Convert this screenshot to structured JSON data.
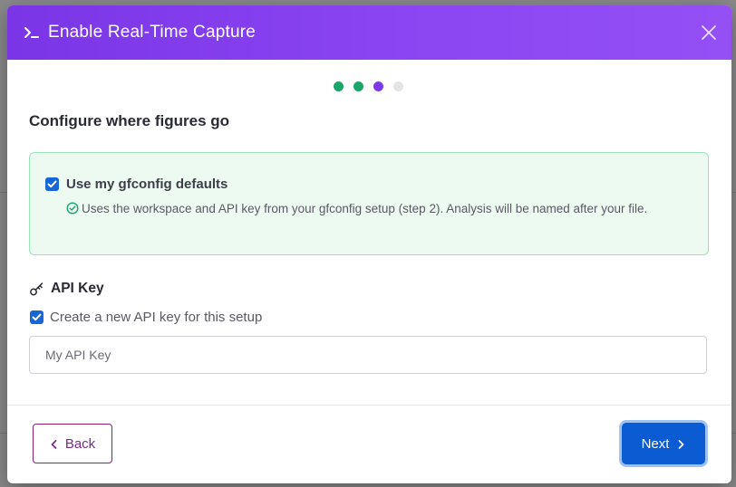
{
  "modal": {
    "title": "Enable Real-Time Capture",
    "close_icon": "close-icon",
    "header_icon": "terminal-icon",
    "header_gradient": [
      "#7a35e6",
      "#9450f5"
    ]
  },
  "stepper": {
    "total_steps": 4,
    "current_step": 3,
    "colors": {
      "completed": "#1aa56b",
      "current": "#7c3aed",
      "upcoming": "#e4e4e7"
    }
  },
  "section": {
    "title": "Configure where figures go"
  },
  "defaults": {
    "checked": true,
    "label": "Use my gfconfig defaults",
    "description": "Uses the workspace and API key from your gfconfig setup (step 2). Analysis will be named after your file.",
    "icon": "check-circle-icon"
  },
  "api_key": {
    "title": "API Key",
    "icon": "key-icon",
    "create_checked": true,
    "create_label": "Create a new API key for this setup",
    "input_value": "",
    "input_placeholder": "My API Key"
  },
  "footer": {
    "back_label": "Back",
    "next_label": "Next"
  },
  "colors": {
    "primary": "#0b5bd3",
    "back_border": "#8a1e7e",
    "success_bg": "#ecfaf1",
    "success_border": "#9be3b9"
  }
}
